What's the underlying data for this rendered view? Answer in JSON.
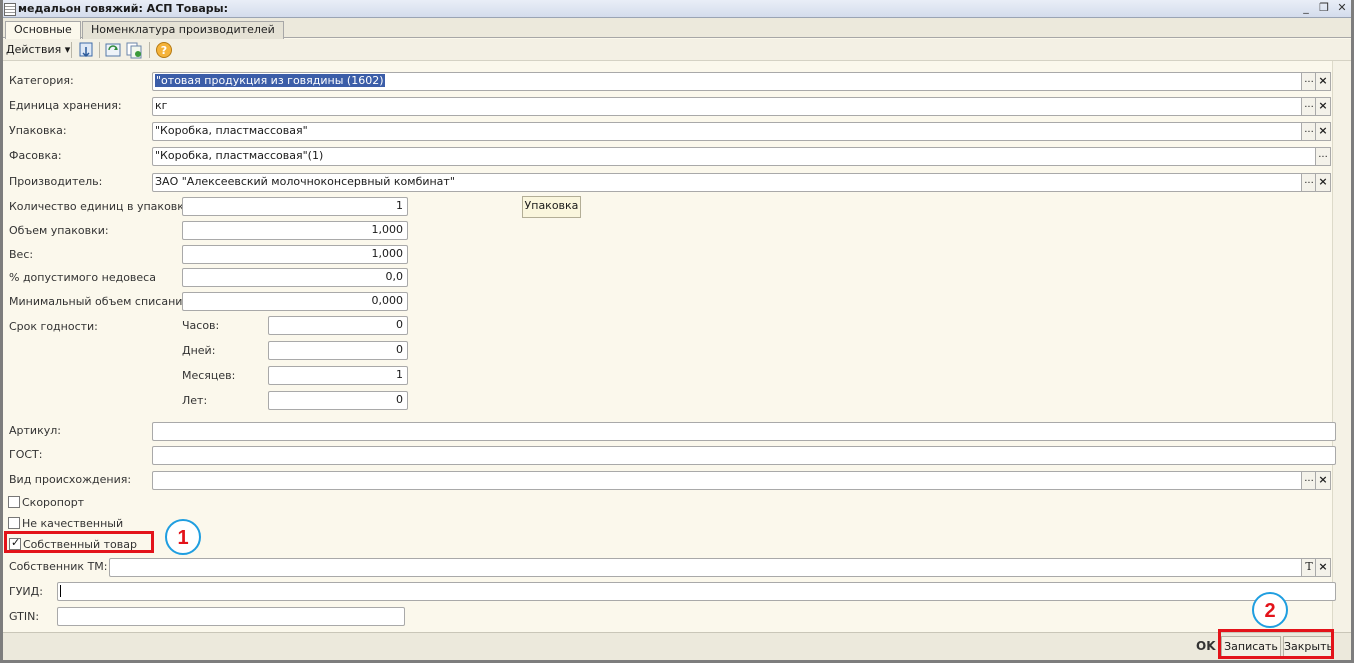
{
  "window": {
    "title": "медальон говяжий: АСП Товары:",
    "controls": [
      "_",
      "❐",
      "✕"
    ]
  },
  "tabs": [
    {
      "label": "Основные",
      "active": true
    },
    {
      "label": "Номенклатура производителей",
      "active": false
    }
  ],
  "toolbar": {
    "actions_label": "Действия",
    "buttons": [
      "save-icon",
      "refresh-icon",
      "copy-icon",
      "help-icon"
    ]
  },
  "form": {
    "category": {
      "label": "Категория:",
      "value": "\"отовая продукция из говядины (1602)"
    },
    "storage_unit": {
      "label": "Единица хранения:",
      "value": "кг"
    },
    "packaging": {
      "label": "Упаковка:",
      "value": "\"Коробка, пластмассовая\""
    },
    "packing": {
      "label": "Фасовка:",
      "value": "\"Коробка, пластмассовая\"(1)"
    },
    "manufacturer": {
      "label": "Производитель:",
      "value": "ЗАО \"Алексеевский молочноконсервный комбинат\""
    },
    "units_in_pack": {
      "label": "Количество единиц в упаковке:",
      "value": "1"
    },
    "pack_button": "Упаковка",
    "pack_volume": {
      "label": "Объем упаковки:",
      "value": "1,000"
    },
    "weight": {
      "label": "Вес:",
      "value": "1,000"
    },
    "underweight": {
      "label": "% допустимого недовеса",
      "value": "0,0"
    },
    "min_writeoff": {
      "label": "Минимальный объем списания:",
      "value": "0,000"
    },
    "shelf_life": {
      "label": "Срок годности:",
      "hours": {
        "label": "Часов:",
        "value": "0"
      },
      "days": {
        "label": "Дней:",
        "value": "0"
      },
      "months": {
        "label": "Месяцев:",
        "value": "1"
      },
      "years": {
        "label": "Лет:",
        "value": "0"
      }
    },
    "article": {
      "label": "Артикул:",
      "value": ""
    },
    "gost": {
      "label": "ГОСТ:",
      "value": ""
    },
    "origin": {
      "label": "Вид происхождения:",
      "value": ""
    },
    "perishable": {
      "label": "Скоропорт",
      "checked": false
    },
    "low_quality": {
      "label": "Не качественный",
      "checked": false
    },
    "own_product": {
      "label": "Собственный товар",
      "checked": true
    },
    "tm_owner": {
      "label": "Собственник ТМ:",
      "value": ""
    },
    "guid": {
      "label": "ГУИД:",
      "value": ""
    },
    "gtin": {
      "label": "GTIN:",
      "value": ""
    }
  },
  "footer": {
    "ok_label": "OK",
    "save_label": "Записать",
    "close_label": "Закрыть"
  },
  "annotations": {
    "marker1": "1",
    "marker2": "2"
  },
  "colors": {
    "highlight": "#e3131a",
    "marker_ring": "#1f9ee0",
    "form_background": "#fbf8ec",
    "selection": "#3b5da8"
  }
}
